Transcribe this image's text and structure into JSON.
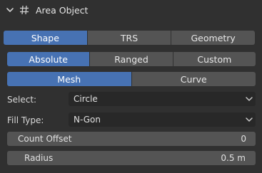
{
  "panel": {
    "title": "Area Object",
    "chevron_icon": "chevron-down-icon",
    "type_icon": "hash-icon"
  },
  "main_tabs": [
    {
      "label": "Shape",
      "active": true
    },
    {
      "label": "TRS",
      "active": false
    },
    {
      "label": "Geometry",
      "active": false
    }
  ],
  "mode_tabs": [
    {
      "label": "Absolute",
      "active": true
    },
    {
      "label": "Ranged",
      "active": false
    },
    {
      "label": "Custom",
      "active": false
    }
  ],
  "source_tabs": [
    {
      "label": "Mesh",
      "active": true
    },
    {
      "label": "Curve",
      "active": false
    }
  ],
  "select": {
    "label": "Select:",
    "value": "Circle"
  },
  "fill_type": {
    "label": "Fill Type:",
    "value": "N-Gon"
  },
  "count_offset": {
    "label": "Count Offset",
    "value": "0"
  },
  "radius": {
    "label": "Radius",
    "value": "0.5 m"
  },
  "colors": {
    "accent": "#4772b3",
    "background": "#303030",
    "button": "#545454",
    "field": "#282828"
  }
}
